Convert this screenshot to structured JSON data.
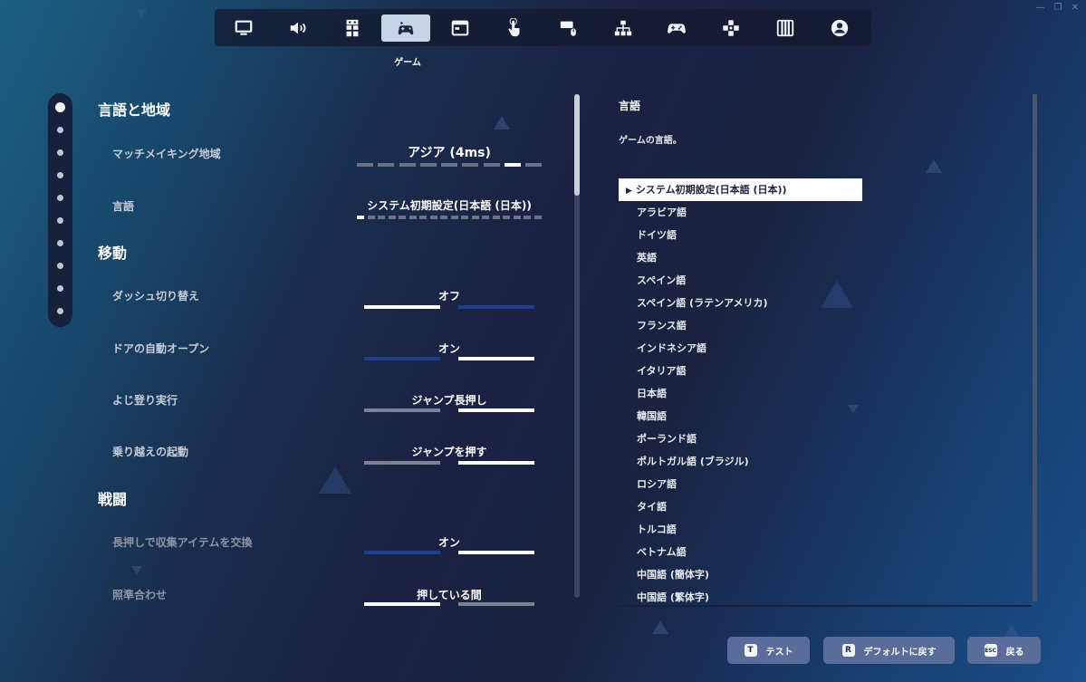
{
  "window": {
    "controls": [
      "—",
      "❐",
      "✕"
    ]
  },
  "nav": {
    "tabs": [
      {
        "icon": "monitor-icon",
        "active": false
      },
      {
        "icon": "speaker-icon",
        "active": false
      },
      {
        "icon": "accessibility-icon",
        "active": false
      },
      {
        "icon": "game-icon",
        "active": true
      },
      {
        "icon": "hud-window-icon",
        "active": false
      },
      {
        "icon": "touch-icon",
        "active": false
      },
      {
        "icon": "keyboard-mouse-icon",
        "active": false
      },
      {
        "icon": "network-icon",
        "active": false
      },
      {
        "icon": "controller-icon",
        "active": false
      },
      {
        "icon": "touch-controls-icon",
        "active": false
      },
      {
        "icon": "audio-mixer-icon",
        "active": false
      },
      {
        "icon": "account-icon",
        "active": false
      }
    ],
    "active_label": "ゲーム"
  },
  "settings": {
    "sections": {
      "region_language": "言語と地域",
      "movement": "移動",
      "combat": "戦闘"
    },
    "rows": {
      "matchmaking": {
        "label": "マッチメイキング地域",
        "value": "アジア (4ms)",
        "segments": 9,
        "selected": 7
      },
      "language": {
        "label": "言語",
        "value": "システム初期設定(日本語 (日本))",
        "segments": 18,
        "selected": 0
      },
      "dash_toggle": {
        "label": "ダッシュ切り替え",
        "value": "オフ"
      },
      "auto_door": {
        "label": "ドアの自動オープン",
        "value": "オン"
      },
      "climb": {
        "label": "よじ登り実行",
        "value": "ジャンプ長押し"
      },
      "mantle": {
        "label": "乗り越えの起動",
        "value": "ジャンプを押す"
      },
      "hold_swap": {
        "label": "長押しで収集アイテムを交換",
        "value": "オン"
      },
      "aim": {
        "label": "照準合わせ",
        "value": "押している間"
      }
    },
    "page_dots": 10,
    "active_dot": 0
  },
  "info": {
    "title": "言語",
    "description": "ゲームの言語。",
    "languages": [
      "システム初期設定(日本語 (日本))",
      "アラビア語",
      "ドイツ語",
      "英語",
      "スペイン語",
      "スペイン語 (ラテンアメリカ)",
      "フランス語",
      "インドネシア語",
      "イタリア語",
      "日本語",
      "韓国語",
      "ポーランド語",
      "ポルトガル語 (ブラジル)",
      "ロシア語",
      "タイ語",
      "トルコ語",
      "ベトナム語",
      "中国語 (簡体字)",
      "中国語 (繁体字)"
    ],
    "selected_index": 0,
    "selected_marker": "▶"
  },
  "footer": {
    "test": {
      "key": "T",
      "label": "テスト"
    },
    "reset": {
      "key": "R",
      "label": "デフォルトに戻す"
    },
    "back": {
      "key": "ESC",
      "label": "戻る"
    }
  },
  "colors": {
    "accent_blue": "#1d3f8e",
    "button_bg": "#5a6d9a",
    "nav_active_bg": "#c8d4e6"
  }
}
